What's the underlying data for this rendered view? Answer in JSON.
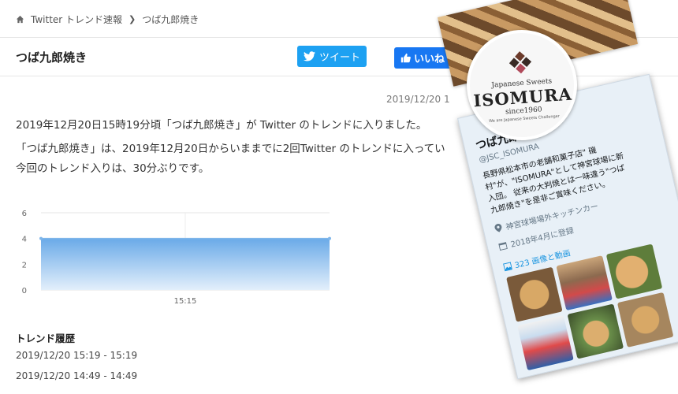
{
  "breadcrumb": {
    "home": "Twitter トレンド速報",
    "current": "つば九郎焼き"
  },
  "page_title": "つば九郎焼き",
  "buttons": {
    "tweet": "ツイート",
    "like": "いいね"
  },
  "date_right": "2019/12/20 1",
  "body": {
    "line1": "2019年12月20日15時19分頃「つば九郎焼き」が Twitter のトレンドに入りました。",
    "line2": "「つば九郎焼き」は、2019年12月20日からいままでに2回Twitter のトレンドに入ってい",
    "line3": "今回のトレンド入りは、30分ぶりです。"
  },
  "chart_data": {
    "type": "area",
    "x": [
      "",
      "",
      ""
    ],
    "x_tick_labels": [
      "15:15"
    ],
    "values": [
      4,
      4,
      4
    ],
    "ylim": [
      0,
      6
    ],
    "y_ticks": [
      "0",
      "2",
      "4",
      "6"
    ],
    "grid": true,
    "color": "#7fb6ea"
  },
  "history": {
    "title": "トレンド履歴",
    "items": [
      "2019/12/20 15:19 - 15:19",
      "2019/12/20 14:49 - 14:49"
    ]
  },
  "profile_card": {
    "logo": {
      "sub": "Japanese Sweets",
      "main": "ISOMURA",
      "since": "since1960",
      "tag": "We are Japanese Sweets Challenger"
    },
    "name": "つば九郎焼き",
    "handle": "@JSC_ISOMURA",
    "bio": "長野県松本市の老舗和菓子店\" 磯\n村\"が、\"ISOMURA\"として神宮球場に新\n入団。 従来の大判焼とは一味違う\"つば\n九郎焼き\"を是非ご賞味ください。",
    "location": "神宮球場場外キッチンカー",
    "joined": "2018年4月に登録",
    "media": "323 画像と動画"
  },
  "colors": {
    "tweet": "#1da1f2",
    "like": "#1877f2",
    "link": "#1b95e0"
  }
}
